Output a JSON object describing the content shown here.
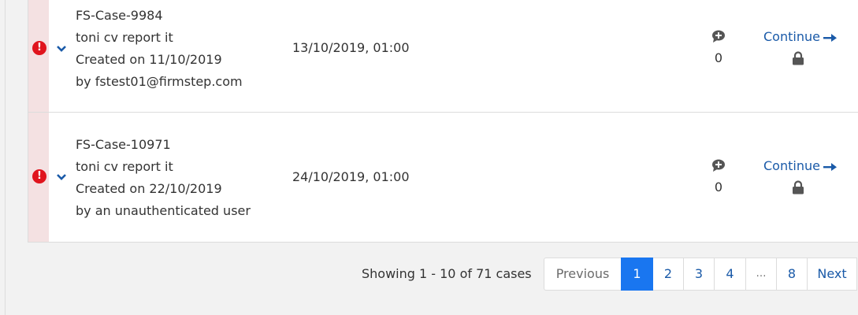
{
  "cases": [
    {
      "id": "FS-Case-9984",
      "title": "toni cv report it",
      "created": "Created on 11/10/2019",
      "by": "by fstest01@firmstep.com",
      "due": "13/10/2019, 01:00",
      "comments": "0",
      "action": "Continue",
      "alert": "!"
    },
    {
      "id": "FS-Case-10971",
      "title": "toni cv report it",
      "created": "Created on 22/10/2019",
      "by": "by an unauthenticated user",
      "due": "24/10/2019, 01:00",
      "comments": "0",
      "action": "Continue",
      "alert": "!"
    }
  ],
  "pagination": {
    "summary": "Showing 1 - 10 of 71 cases",
    "previous": "Previous",
    "pages": [
      "1",
      "2",
      "3",
      "4",
      "…",
      "8"
    ],
    "current": "1",
    "next": "Next"
  },
  "colors": {
    "alert": "#e0141d",
    "link": "#1a5aa8",
    "active_page": "#1976f0",
    "row_flag": "#f4e1e2"
  },
  "icons": [
    "alert-circle-icon",
    "chevron-down-icon",
    "comment-plus-icon",
    "arrow-right-icon",
    "lock-icon"
  ]
}
